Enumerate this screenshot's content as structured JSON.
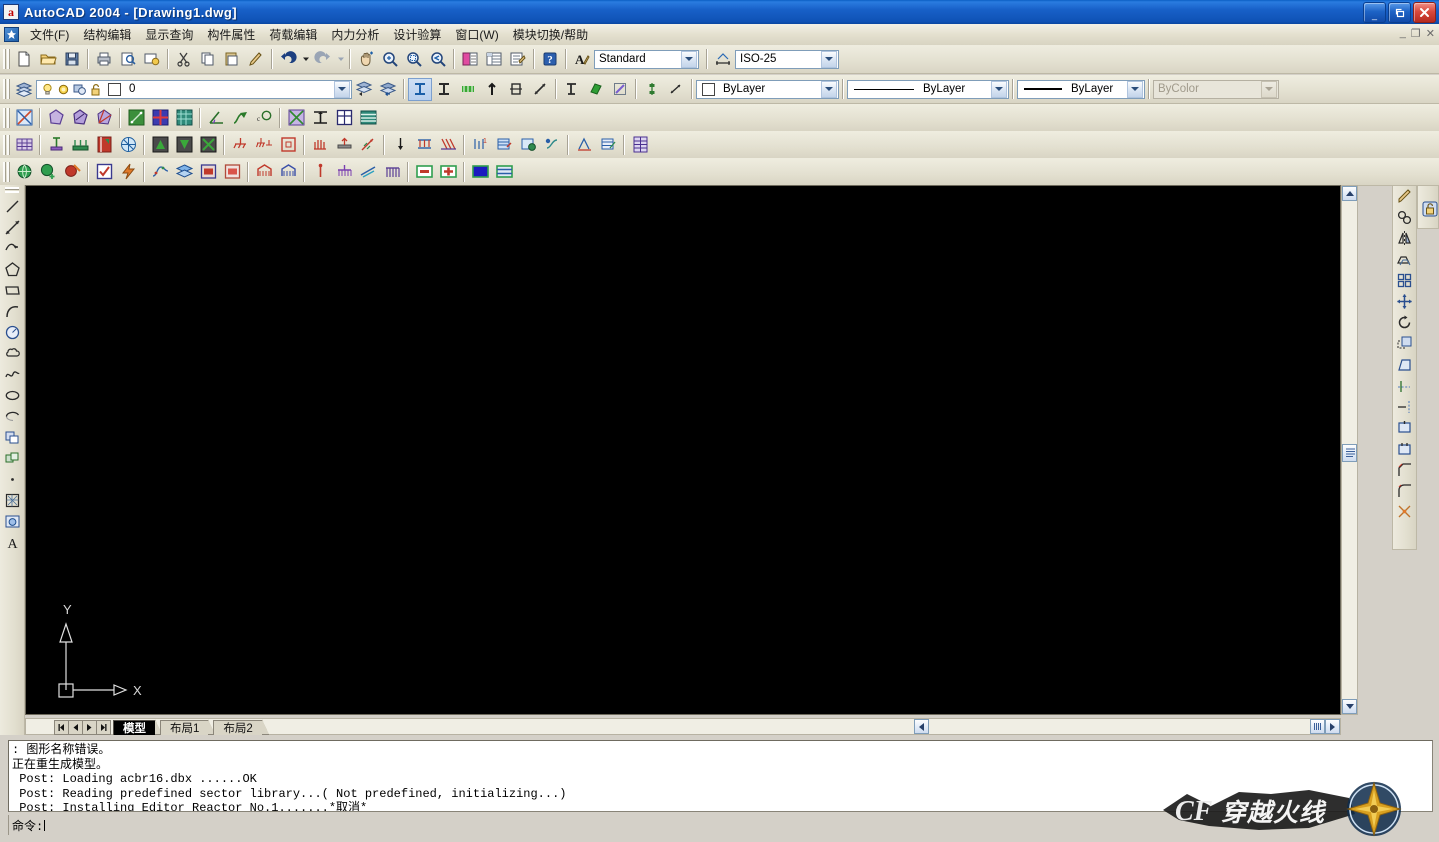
{
  "window": {
    "title": "AutoCAD 2004 - [Drawing1.dwg]",
    "app_icon": "autocad-a-icon",
    "minimize_label": "_",
    "restore_label": "❐",
    "close_label": "✕",
    "mdi_minimize": "_",
    "mdi_restore": "❐",
    "mdi_close": "✕"
  },
  "menubar": {
    "app_icon": "pkpm-app-icon",
    "items": [
      {
        "label": "文件(F)",
        "name": "menu-file"
      },
      {
        "label": "结构编辑",
        "name": "menu-structure-edit"
      },
      {
        "label": "显示查询",
        "name": "menu-display-query"
      },
      {
        "label": "构件属性",
        "name": "menu-member-properties"
      },
      {
        "label": "荷载编辑",
        "name": "menu-load-edit"
      },
      {
        "label": "内力分析",
        "name": "menu-internal-force-analysis"
      },
      {
        "label": "设计验算",
        "name": "menu-design-check"
      },
      {
        "label": "窗口(W)",
        "name": "menu-window"
      },
      {
        "label": "模块切换/帮助",
        "name": "menu-module-switch-help"
      }
    ]
  },
  "toolbars": {
    "standard": {
      "buttons": [
        "new-icon",
        "open-icon",
        "save-icon",
        "print-icon",
        "print-preview-icon",
        "publish-icon",
        "cut-icon",
        "copy-icon",
        "paste-icon",
        "match-properties-icon",
        "undo-icon",
        "undo-dropdown-icon",
        "redo-icon",
        "redo-dropdown-icon",
        "pan-realtime-icon",
        "zoom-realtime-icon",
        "zoom-window-icon",
        "zoom-previous-icon",
        "properties-icon",
        "designcenter-icon",
        "tool-palettes-icon",
        "help-icon"
      ]
    },
    "styles": {
      "text_style_icon": "text-style-icon",
      "text_style_value": "Standard",
      "dim_style_icon": "dimension-style-icon",
      "dim_style_value": "ISO-25"
    },
    "layers": {
      "layer_manager_icon": "layer-properties-manager-icon",
      "state_icons": [
        "lightbulb-on-icon",
        "sun-freeze-icon",
        "freeze-viewport-icon",
        "unlock-icon"
      ],
      "color_swatch": "#ffffff",
      "current_layer": "0",
      "make_current_icon": "make-object-layer-current-icon",
      "layer_previous_icon": "layer-previous-icon"
    },
    "osnap": {
      "buttons": [
        "snap-insert-icon",
        "snap-midpoint-icon",
        "snap-node-icon",
        "snap-perpendicular-icon",
        "snap-quadrant-icon",
        "snap-nearest-icon",
        "snap-insertion-icon",
        "snap-apparent-icon",
        "snap-parallel-icon",
        "snap-extension-icon",
        "snap-settings-icon"
      ]
    },
    "properties": {
      "color": {
        "swatch": "#ffffff",
        "value": "ByLayer"
      },
      "linetype": {
        "value": "ByLayer"
      },
      "lineweight": {
        "value": "ByLayer"
      },
      "plotstyle": {
        "value": "ByColor",
        "disabled": true
      }
    },
    "pkpm_row_a": {
      "buttons": [
        "axis-network-icon",
        "grid-polygon-icon",
        "grid-arc-icon",
        "grid-fan-icon",
        "grid-orthogonal-icon",
        "grid-cross-icon",
        "grid-mesh-icon",
        "angle-dim-icon",
        "arrow-node-icon",
        "circle-node-icon",
        "delete-grid-icon",
        "beam-section-icon",
        "slab-grid-icon",
        "wall-band-icon"
      ]
    },
    "pkpm_row_b": {
      "buttons": [
        "floor-grid-icon",
        "column-icon",
        "beam-icon",
        "wall-icon",
        "slab-icon",
        "material-a-icon",
        "material-b-icon",
        "material-c-icon",
        "support-icon",
        "support-group-icon",
        "node-frame-icon",
        "load-hand-icon",
        "load-base-icon",
        "wind-load-icon",
        "point-load-icon",
        "line-load-icon",
        "area-load-icon",
        "load-edit-1-icon",
        "load-edit-2-icon",
        "load-edit-3-icon",
        "load-edit-4-icon",
        "load-calc-1-icon",
        "load-calc-2-icon",
        "load-table-icon"
      ]
    },
    "pkpm_row_c": {
      "buttons": [
        "globe-icon",
        "globe-add-icon",
        "globe-delete-icon",
        "check-box-icon",
        "lightning-icon",
        "chart-curve-icon",
        "layers-blue-icon",
        "window-red-1-icon",
        "window-red-2-icon",
        "roof-red-icon",
        "roof-blue-icon",
        "pile-icon",
        "foundation-icon",
        "raft-icon",
        "pile-group-icon",
        "minus-green-icon",
        "plus-green-icon",
        "panel-blue-icon",
        "panel-stripe-icon"
      ]
    },
    "draw": {
      "buttons": [
        "line-icon",
        "construction-line-icon",
        "polyline-icon",
        "polygon-icon",
        "rectangle-icon",
        "arc-icon",
        "circle-icon",
        "revision-cloud-icon",
        "spline-icon",
        "ellipse-icon",
        "ellipse-arc-icon",
        "insert-block-icon",
        "make-block-icon",
        "point-icon",
        "hatch-icon",
        "region-icon",
        "multiline-text-icon"
      ]
    },
    "modify": {
      "buttons": [
        "erase-icon",
        "copy-object-icon",
        "mirror-icon",
        "offset-icon",
        "array-icon",
        "move-icon",
        "rotate-icon",
        "scale-icon",
        "stretch-icon",
        "trim-icon",
        "extend-icon",
        "break-at-point-icon",
        "break-icon",
        "chamfer-icon",
        "fillet-icon",
        "explode-icon"
      ]
    },
    "misc": {
      "buttons": [
        "lock-ui-icon"
      ]
    }
  },
  "drawing": {
    "background": "#000000",
    "ucs_icon": {
      "x_label": "X",
      "y_label": "Y",
      "name": "ucs-icon"
    }
  },
  "tabs": {
    "nav": [
      "first-tab-icon",
      "prev-tab-icon",
      "next-tab-icon",
      "last-tab-icon"
    ],
    "items": [
      {
        "label": "模型",
        "active": true
      },
      {
        "label": "布局1",
        "active": false
      },
      {
        "label": "布局2",
        "active": false
      }
    ]
  },
  "command": {
    "history": [
      ": 图形名称错误。",
      "正在重生成模型。",
      " Post: Loading acbr16.dbx ......OK",
      " Post: Reading predefined sector library...( Not predefined, initializing...)",
      " Post: Installing Editor Reactor No.1.......*取消*"
    ],
    "prompt": "命令:"
  },
  "watermark": {
    "logo_mark": "CF",
    "logo_text": "穿越火线",
    "star_icon": "compass-star-icon"
  },
  "colors": {
    "title_blue": "#1860c8",
    "toolbar_bg": "#e3e0d0",
    "canvas_black": "#000000",
    "accent_green": "#00a000",
    "accent_red": "#c00000"
  }
}
